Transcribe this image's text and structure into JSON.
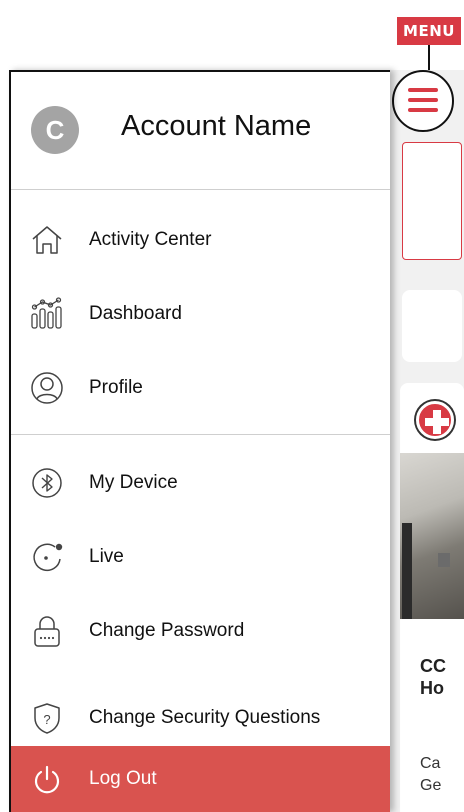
{
  "annotation": {
    "menu_tag": "MENU"
  },
  "drawer": {
    "account": {
      "avatar_letter": "C",
      "name": "Account Name"
    },
    "items": [
      {
        "label": "Activity Center",
        "icon": "home-icon"
      },
      {
        "label": "Dashboard",
        "icon": "dashboard-icon"
      },
      {
        "label": "Profile",
        "icon": "profile-icon"
      },
      {
        "label": "My Device",
        "icon": "bluetooth-icon"
      },
      {
        "label": "Live",
        "icon": "live-icon"
      },
      {
        "label": "Change Password",
        "icon": "lock-icon"
      },
      {
        "label": "Change Security Questions",
        "icon": "shield-question-icon"
      }
    ],
    "logout": {
      "label": "Log Out",
      "icon": "power-icon"
    }
  },
  "background_app": {
    "title_fragment_1": "CC",
    "title_fragment_2": "Ho",
    "body_fragment_1": "Ca",
    "body_fragment_2": "Ge"
  },
  "colors": {
    "accent": "#d83a44",
    "logout_bg": "#d9534f",
    "divider": "#cfcfcf",
    "avatar": "#a4a4a4"
  }
}
